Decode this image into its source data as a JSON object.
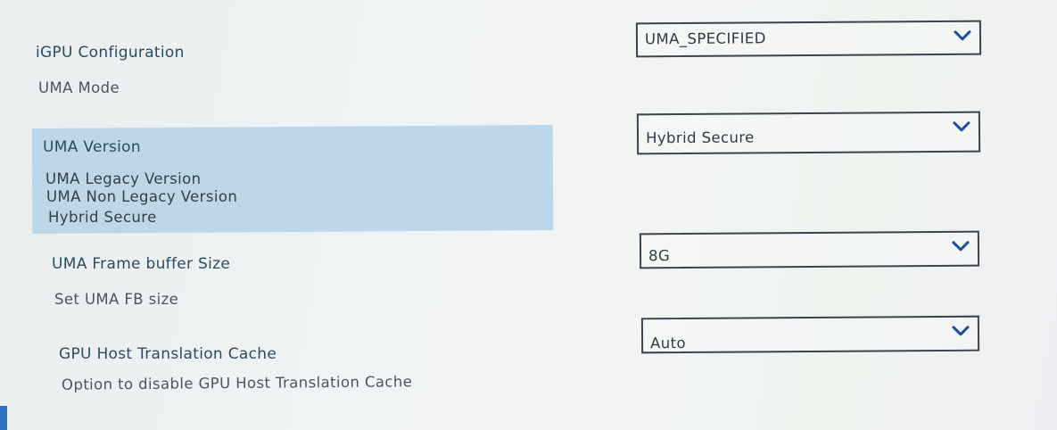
{
  "settings": [
    {
      "title": "iGPU Configuration",
      "description": "UMA Mode",
      "selected_value": "UMA_SPECIFIED"
    },
    {
      "title": "UMA Version",
      "options": [
        "UMA Legacy Version",
        "UMA Non Legacy Version",
        "Hybrid Secure"
      ],
      "selected_value": "Hybrid Secure"
    },
    {
      "title": "UMA Frame buffer Size",
      "description": "Set UMA FB size",
      "selected_value": "8G"
    },
    {
      "title": "GPU Host Translation Cache",
      "description": "Option to disable GPU Host Translation Cache",
      "selected_value": "Auto"
    }
  ],
  "icons": {
    "dropdown": "chevron-down-icon"
  },
  "colors": {
    "highlight": "#bcd7ea",
    "title_text": "#2d4a63",
    "border": "#3a4350"
  }
}
